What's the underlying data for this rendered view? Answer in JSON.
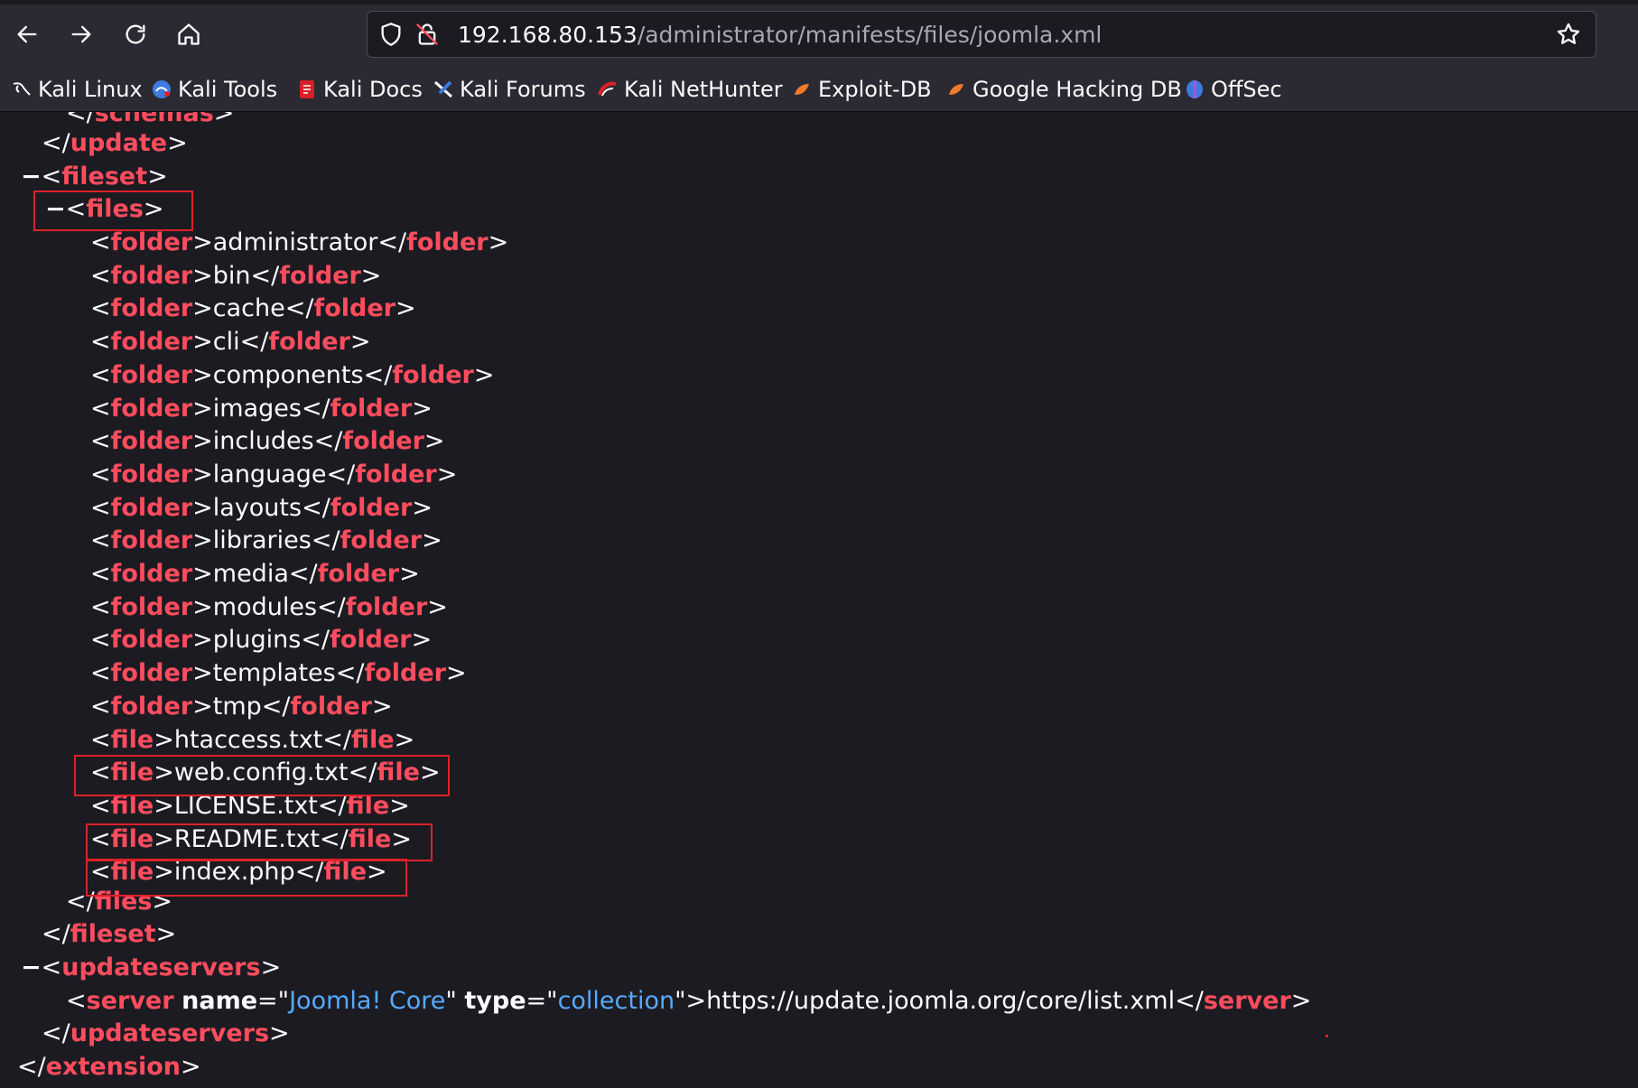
{
  "browser": {
    "url_host": "192.168.80.153",
    "url_path": "/administrator/manifests/files/joomla.xml",
    "icons": [
      "back-icon",
      "forward-icon",
      "reload-icon",
      "home-icon",
      "shield-icon",
      "insecure-lock-icon",
      "star-icon"
    ]
  },
  "bookmarks": [
    {
      "label": "Kali Linux",
      "icon": "kali-dragon-icon"
    },
    {
      "label": "Kali Tools",
      "icon": "kali-tools-icon"
    },
    {
      "label": "Kali Docs",
      "icon": "kali-docs-icon"
    },
    {
      "label": "Kali Forums",
      "icon": "kali-forums-icon"
    },
    {
      "label": "Kali NetHunter",
      "icon": "kali-nethunter-icon"
    },
    {
      "label": "Exploit-DB",
      "icon": "exploit-db-icon"
    },
    {
      "label": "Google Hacking DB",
      "icon": "ghdb-icon"
    },
    {
      "label": "OffSec",
      "icon": "offsec-icon"
    }
  ],
  "xml": {
    "schemas_close_tag": "schemas",
    "update_close_tag": "update",
    "fileset_tag": "fileset",
    "files_tag": "files",
    "folder_tag": "folder",
    "file_tag": "file",
    "collapse_marker": "−",
    "folders": [
      "administrator",
      "bin",
      "cache",
      "cli",
      "components",
      "images",
      "includes",
      "language",
      "layouts",
      "libraries",
      "media",
      "modules",
      "plugins",
      "templates",
      "tmp"
    ],
    "files": [
      "htaccess.txt",
      "web.config.txt",
      "LICENSE.txt",
      "README.txt",
      "index.php"
    ],
    "updateservers_tag": "updateservers",
    "server": {
      "tag": "server",
      "attr_name": "name",
      "attr_name_value": "Joomla! Core",
      "attr_type": "type",
      "attr_type_value": "collection",
      "text": "https://update.joomla.org/core/list.xml"
    },
    "extension_tag": "extension"
  },
  "colors": {
    "tag": "#ff4d5e",
    "text": "#fbfbfe",
    "attr_value": "#57aaff",
    "highlight_box": "#e02027",
    "background": "#1c1b22"
  }
}
